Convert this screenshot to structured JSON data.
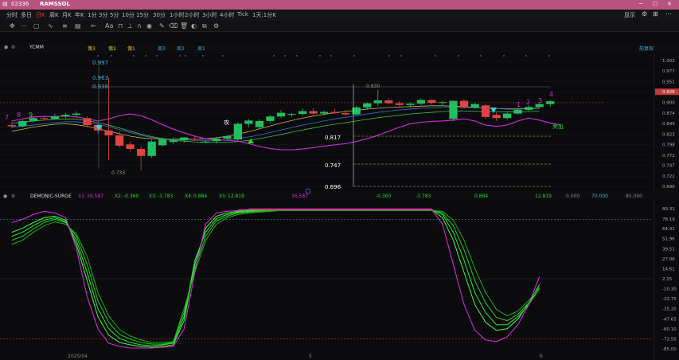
{
  "titlebar": {
    "symbol_code": "02336",
    "symbol_name": "RAMSSOL"
  },
  "periods": [
    "分时",
    "多日",
    "日K",
    "周K",
    "月K",
    "年K",
    "1分",
    "3分",
    "5分",
    "10分",
    "15分",
    "30分",
    "1小时",
    "2小时",
    "3小时",
    "4小时",
    "Tick",
    "1天:1分K"
  ],
  "active_period": "日K",
  "top_right": {
    "display_label": "显示"
  },
  "chart_header": {
    "indicator": "YCMM",
    "markers": [
      "傀3",
      "傀2",
      "傀1",
      "周3",
      "周2",
      "周1"
    ],
    "fuquan": "前复权"
  },
  "main_axis": {
    "ticks": [
      "1.002",
      "0.977",
      "0.951",
      "0.926",
      "0.900",
      "0.874",
      "0.849",
      "0.823",
      "0.798",
      "0.772",
      "0.747",
      "0.721",
      "0.696"
    ],
    "current_price": "0.926"
  },
  "annotations": {
    "level_997": "0.997",
    "level_963": "0.963",
    "level_938": "0.938",
    "level_930": "0.930",
    "level_817": "0.817",
    "level_747": "0.747",
    "level_696": "0.696",
    "low_735": "0.735",
    "attack_label": "攻",
    "sell_label": "卖出",
    "count_left": [
      "7",
      "8",
      "9"
    ],
    "count_right": [
      "1",
      "2",
      "3",
      "4"
    ]
  },
  "sub_header": {
    "name": "DEMONIC-SURGE",
    "x1_label": "X1:",
    "x1": "36.587",
    "x2_label": "X2:",
    "x2": "-0.360",
    "x3_label": "X3:",
    "x3": "-3.783",
    "x4_label": "X4:",
    "x4": "0.884",
    "x5_label": "X5:",
    "x5": "12.819",
    "mid_values": [
      "36.587",
      "-0.360",
      "-3.783",
      "0.884",
      "12.819",
      "0.000",
      "70.000",
      "85.000"
    ]
  },
  "sub_axis": {
    "ticks": [
      "89.31",
      "76.19",
      "64.41",
      "51.96",
      "39.51",
      "27.06",
      "14.61",
      "2.15",
      "-10.30",
      "-22.75",
      "-35.20",
      "-47.65",
      "-60.10",
      "-72.55",
      "-85.00"
    ]
  },
  "x_axis": {
    "labels": [
      "2025/04",
      "5",
      "6"
    ]
  },
  "colors": {
    "up": "#e04444",
    "down": "#20c060",
    "magenta": "#d22ad8",
    "green_line": "#22dd22",
    "gold": "#c8b040",
    "cyan": "#3ab0d0"
  },
  "chart_data": {
    "type": "candlestick",
    "candles": [
      {
        "o": 0.845,
        "h": 0.852,
        "l": 0.838,
        "c": 0.842
      },
      {
        "o": 0.842,
        "h": 0.858,
        "l": 0.84,
        "c": 0.855
      },
      {
        "o": 0.855,
        "h": 0.866,
        "l": 0.85,
        "c": 0.862
      },
      {
        "o": 0.862,
        "h": 0.868,
        "l": 0.856,
        "c": 0.86
      },
      {
        "o": 0.86,
        "h": 0.872,
        "l": 0.858,
        "c": 0.866
      },
      {
        "o": 0.866,
        "h": 0.875,
        "l": 0.862,
        "c": 0.87
      },
      {
        "o": 0.87,
        "h": 0.878,
        "l": 0.864,
        "c": 0.873
      },
      {
        "o": 0.862,
        "h": 0.866,
        "l": 0.84,
        "c": 0.845
      },
      {
        "o": 0.845,
        "h": 0.849,
        "l": 0.825,
        "c": 0.832
      },
      {
        "o": 0.832,
        "h": 0.96,
        "l": 0.76,
        "c": 0.82
      },
      {
        "o": 0.82,
        "h": 0.83,
        "l": 0.79,
        "c": 0.795
      },
      {
        "o": 0.798,
        "h": 0.805,
        "l": 0.78,
        "c": 0.787
      },
      {
        "o": 0.787,
        "h": 0.795,
        "l": 0.735,
        "c": 0.77
      },
      {
        "o": 0.77,
        "h": 0.81,
        "l": 0.765,
        "c": 0.805
      },
      {
        "o": 0.796,
        "h": 0.815,
        "l": 0.792,
        "c": 0.81
      },
      {
        "o": 0.804,
        "h": 0.815,
        "l": 0.799,
        "c": 0.808
      },
      {
        "o": 0.808,
        "h": 0.816,
        "l": 0.802,
        "c": 0.815
      },
      {
        "o": 0.812,
        "h": 0.82,
        "l": 0.806,
        "c": 0.81
      },
      {
        "o": 0.803,
        "h": 0.809,
        "l": 0.8,
        "c": 0.805
      },
      {
        "o": 0.806,
        "h": 0.816,
        "l": 0.8,
        "c": 0.812
      },
      {
        "o": 0.812,
        "h": 0.82,
        "l": 0.808,
        "c": 0.818
      },
      {
        "o": 0.81,
        "h": 0.852,
        "l": 0.805,
        "c": 0.848
      },
      {
        "o": 0.848,
        "h": 0.86,
        "l": 0.84,
        "c": 0.856
      },
      {
        "o": 0.84,
        "h": 0.86,
        "l": 0.835,
        "c": 0.855
      },
      {
        "o": 0.855,
        "h": 0.87,
        "l": 0.85,
        "c": 0.866
      },
      {
        "o": 0.866,
        "h": 0.882,
        "l": 0.862,
        "c": 0.875
      },
      {
        "o": 0.87,
        "h": 0.875,
        "l": 0.865,
        "c": 0.872
      },
      {
        "o": 0.872,
        "h": 0.885,
        "l": 0.868,
        "c": 0.879
      },
      {
        "o": 0.879,
        "h": 0.886,
        "l": 0.87,
        "c": 0.873
      },
      {
        "o": 0.873,
        "h": 0.88,
        "l": 0.868,
        "c": 0.877
      },
      {
        "o": 0.877,
        "h": 0.885,
        "l": 0.872,
        "c": 0.874
      },
      {
        "o": 0.874,
        "h": 0.882,
        "l": 0.868,
        "c": 0.871
      },
      {
        "o": 0.871,
        "h": 0.892,
        "l": 0.868,
        "c": 0.888
      },
      {
        "o": 0.888,
        "h": 0.9,
        "l": 0.882,
        "c": 0.898
      },
      {
        "o": 0.898,
        "h": 0.93,
        "l": 0.892,
        "c": 0.905
      },
      {
        "o": 0.905,
        "h": 0.91,
        "l": 0.895,
        "c": 0.898
      },
      {
        "o": 0.898,
        "h": 0.903,
        "l": 0.89,
        "c": 0.894
      },
      {
        "o": 0.894,
        "h": 0.9,
        "l": 0.888,
        "c": 0.897
      },
      {
        "o": 0.897,
        "h": 0.91,
        "l": 0.893,
        "c": 0.906
      },
      {
        "o": 0.906,
        "h": 0.908,
        "l": 0.895,
        "c": 0.899
      },
      {
        "o": 0.899,
        "h": 0.905,
        "l": 0.892,
        "c": 0.901
      },
      {
        "o": 0.86,
        "h": 0.905,
        "l": 0.855,
        "c": 0.904
      },
      {
        "o": 0.904,
        "h": 0.908,
        "l": 0.885,
        "c": 0.888
      },
      {
        "o": 0.888,
        "h": 0.9,
        "l": 0.884,
        "c": 0.896
      },
      {
        "o": 0.893,
        "h": 0.897,
        "l": 0.86,
        "c": 0.865
      },
      {
        "o": 0.87,
        "h": 0.876,
        "l": 0.855,
        "c": 0.862
      },
      {
        "o": 0.862,
        "h": 0.875,
        "l": 0.858,
        "c": 0.873
      },
      {
        "o": 0.873,
        "h": 0.885,
        "l": 0.87,
        "c": 0.882
      },
      {
        "o": 0.882,
        "h": 0.893,
        "l": 0.878,
        "c": 0.889
      },
      {
        "o": 0.889,
        "h": 0.9,
        "l": 0.885,
        "c": 0.896
      },
      {
        "o": 0.896,
        "h": 0.906,
        "l": 0.89,
        "c": 0.903
      }
    ],
    "ma_lines": [
      {
        "name": "",
        "color": "#c8b040",
        "values": [
          0.83,
          0.835,
          0.84,
          0.844,
          0.847,
          0.848,
          0.846,
          0.842,
          0.836,
          0.83,
          0.824,
          0.818,
          0.814,
          0.812,
          0.811,
          0.811,
          0.811,
          0.811,
          0.812,
          0.814,
          0.818,
          0.823,
          0.829,
          0.836,
          0.843,
          0.85,
          0.856,
          0.862,
          0.867,
          0.871,
          0.875,
          0.878,
          0.881,
          0.884,
          0.886,
          0.888,
          0.889,
          0.89,
          0.891,
          0.892,
          0.892,
          0.891,
          0.89,
          0.888,
          0.886,
          0.885,
          0.884,
          0.884,
          0.885,
          0.886
        ]
      },
      {
        "name": "",
        "color": "#3b6fd8",
        "values": [
          0.84,
          0.842,
          0.845,
          0.848,
          0.851,
          0.853,
          0.853,
          0.851,
          0.847,
          0.841,
          0.834,
          0.827,
          0.82,
          0.815,
          0.812,
          0.81,
          0.809,
          0.808,
          0.808,
          0.808,
          0.809,
          0.812,
          0.816,
          0.821,
          0.827,
          0.833,
          0.839,
          0.845,
          0.85,
          0.855,
          0.86,
          0.864,
          0.868,
          0.872,
          0.876,
          0.879,
          0.882,
          0.884,
          0.886,
          0.887,
          0.888,
          0.888,
          0.888,
          0.887,
          0.886,
          0.885,
          0.885,
          0.885,
          0.886,
          0.887
        ]
      },
      {
        "name": "",
        "color": "#3fbf4a",
        "values": [
          0.85,
          0.852,
          0.855,
          0.857,
          0.859,
          0.86,
          0.859,
          0.856,
          0.851,
          0.845,
          0.838,
          0.83,
          0.823,
          0.817,
          0.812,
          0.808,
          0.806,
          0.804,
          0.803,
          0.803,
          0.803,
          0.805,
          0.808,
          0.812,
          0.817,
          0.822,
          0.828,
          0.833,
          0.838,
          0.843,
          0.847,
          0.851,
          0.855,
          0.859,
          0.863,
          0.866,
          0.869,
          0.872,
          0.874,
          0.876,
          0.878,
          0.879,
          0.879,
          0.879,
          0.878,
          0.878,
          0.877,
          0.877,
          0.878,
          0.879
        ]
      },
      {
        "name": "",
        "color": "#c02ad0",
        "values": [
          0.855,
          0.86,
          0.865,
          0.866,
          0.866,
          0.867,
          0.865,
          0.86,
          0.855,
          0.86,
          0.868,
          0.872,
          0.868,
          0.858,
          0.846,
          0.835,
          0.826,
          0.818,
          0.812,
          0.809,
          0.808,
          0.806,
          0.8,
          0.793,
          0.788,
          0.785,
          0.785,
          0.787,
          0.79,
          0.794,
          0.797,
          0.8,
          0.805,
          0.812,
          0.82,
          0.83,
          0.84,
          0.848,
          0.852,
          0.854,
          0.855,
          0.857,
          0.86,
          0.855,
          0.845,
          0.842,
          0.845,
          0.855,
          0.862,
          0.857,
          0.85,
          0.845
        ]
      }
    ],
    "oscillator": {
      "magenta": [
        72,
        76,
        82,
        86,
        84,
        78,
        40,
        -20,
        -60,
        -78,
        -82,
        -84,
        -84,
        -84,
        -83,
        -82,
        -60,
        10,
        70,
        84,
        86,
        87,
        88,
        88,
        88,
        88,
        88,
        88,
        88,
        88,
        88,
        88,
        88,
        88,
        88,
        88,
        88,
        88,
        88,
        88,
        70,
        20,
        -30,
        -62,
        -74,
        -76,
        -70,
        -55,
        -30,
        5
      ],
      "greens": [
        [
          60,
          65,
          72,
          78,
          80,
          75,
          45,
          0,
          -45,
          -68,
          -77,
          -80,
          -82,
          -83,
          -82,
          -80,
          -50,
          20,
          65,
          80,
          84,
          86,
          87,
          88,
          88,
          88,
          88,
          88,
          88,
          88,
          88,
          88,
          88,
          88,
          88,
          88,
          88,
          88,
          88,
          88,
          78,
          50,
          10,
          -30,
          -52,
          -62,
          -60,
          -48,
          -28,
          -5
        ],
        [
          55,
          60,
          68,
          75,
          78,
          73,
          50,
          10,
          -35,
          -60,
          -72,
          -77,
          -80,
          -81,
          -80,
          -78,
          -45,
          25,
          60,
          77,
          82,
          85,
          86,
          87,
          88,
          88,
          88,
          88,
          88,
          88,
          88,
          88,
          88,
          88,
          88,
          88,
          88,
          88,
          88,
          88,
          82,
          60,
          25,
          -15,
          -40,
          -55,
          -55,
          -45,
          -30,
          -10
        ],
        [
          50,
          55,
          64,
          72,
          76,
          72,
          55,
          20,
          -25,
          -52,
          -67,
          -73,
          -77,
          -79,
          -79,
          -77,
          -40,
          15,
          55,
          74,
          80,
          84,
          85,
          86,
          87,
          88,
          88,
          88,
          88,
          88,
          88,
          88,
          88,
          88,
          88,
          88,
          88,
          88,
          88,
          88,
          84,
          68,
          38,
          0,
          -28,
          -46,
          -50,
          -42,
          -28,
          -10
        ],
        [
          45,
          50,
          60,
          68,
          73,
          70,
          58,
          30,
          -15,
          -44,
          -61,
          -69,
          -74,
          -77,
          -77,
          -76,
          -35,
          10,
          50,
          70,
          78,
          82,
          84,
          85,
          86,
          87,
          87,
          87,
          87,
          87,
          87,
          87,
          87,
          87,
          87,
          87,
          87,
          87,
          87,
          87,
          86,
          75,
          50,
          15,
          -15,
          -36,
          -44,
          -38,
          -25,
          -8
        ]
      ]
    }
  }
}
